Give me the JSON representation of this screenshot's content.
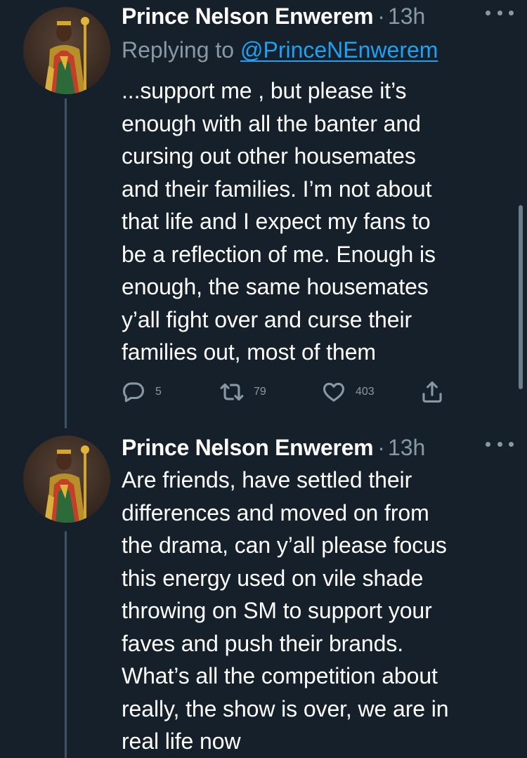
{
  "tweets": [
    {
      "author_name": "Prince Nelson Enwerem",
      "separator": "·",
      "time": "13h",
      "replying_label": "Replying to ",
      "replying_handle": "@PrinceNEnwerem",
      "text": "...support me , but please it’s\nenough with all the banter and\ncursing out other housemates\nand their families. I’m not about\nthat life and I expect my fans to\nbe a reflection of me. Enough is\nenough, the same housemates\ny’all fight over and curse their\nfamilies out, most of them",
      "actions": {
        "reply_count": "5",
        "retweet_count": "79",
        "like_count": "403"
      }
    },
    {
      "author_name": "Prince Nelson Enwerem",
      "separator": "·",
      "time": "13h",
      "text": "Are friends,  have settled their\ndifferences and moved on from\nthe drama, can y’all please focus\nthis energy used on vile shade\nthrowing on SM to support your\nfaves and push their brands.\nWhat’s all the competition about\nreally, the show is over, we are in\nreal life now"
    }
  ],
  "icons": {
    "more": "more-dots-icon",
    "reply": "reply-bubble-icon",
    "retweet": "retweet-icon",
    "like": "heart-icon",
    "share": "share-icon"
  },
  "colors": {
    "background": "#15202b",
    "secondary_text": "#8899a6",
    "link": "#1da1f2",
    "thread_line": "#3d5466"
  }
}
